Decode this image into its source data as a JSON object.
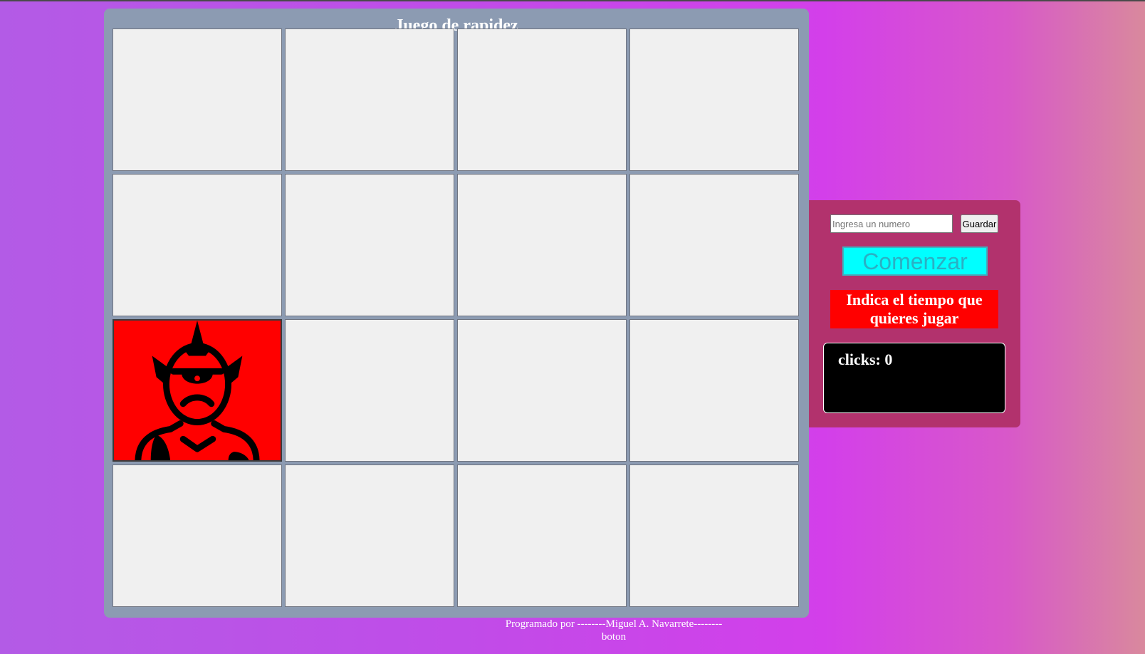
{
  "game": {
    "title": "Juego de rapidez",
    "grid_rows": 4,
    "grid_cols": 4,
    "active_cell": {
      "row": 3,
      "col": 1
    },
    "monster_icon": "cyclops-monster-icon",
    "colors": {
      "board": "#8c9bb2",
      "cell": "#f0f0f0",
      "active_cell": "#ff0000"
    }
  },
  "panel": {
    "input_placeholder": "Ingresa un numero",
    "input_value": "",
    "save_label": "Guardar",
    "start_label": "Comenzar",
    "instruction": "Indica el tiempo que quieres jugar",
    "clicks_label": "clicks: 0",
    "colors": {
      "panel": "#b2326d",
      "start_button": "#00ffff",
      "instruction_bg": "#ff0000",
      "clicks_bg": "#000000"
    }
  },
  "footer": {
    "credit": "Programado por --------Miguel A. Navarrete--------",
    "link": "boton"
  }
}
